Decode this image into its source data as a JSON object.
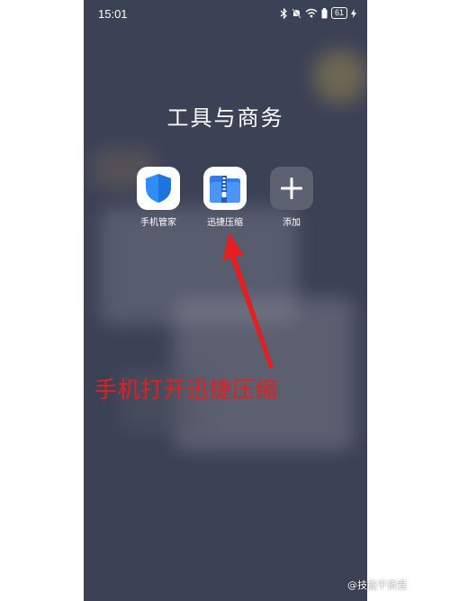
{
  "status_bar": {
    "time": "15:01",
    "battery": "61",
    "icons": [
      "bluetooth-icon",
      "mute-icon",
      "wifi-icon",
      "battery-saver-icon",
      "battery-icon",
      "charging-icon"
    ]
  },
  "folder": {
    "title": "工具与商务",
    "apps": [
      {
        "label": "手机管家",
        "icon": "shield-icon"
      },
      {
        "label": "迅捷压缩",
        "icon": "zip-folder-icon"
      },
      {
        "label": "添加",
        "icon": "plus-icon"
      }
    ]
  },
  "annotation": {
    "text": "手机打开迅捷压缩",
    "color": "#e61e1e"
  },
  "watermark": {
    "text": "@技能干货君"
  },
  "colors": {
    "background": "#3c4256",
    "shield": "#2f8ef5",
    "zip_folder": "#2f7cf0",
    "add_tile": "#5d6273"
  }
}
